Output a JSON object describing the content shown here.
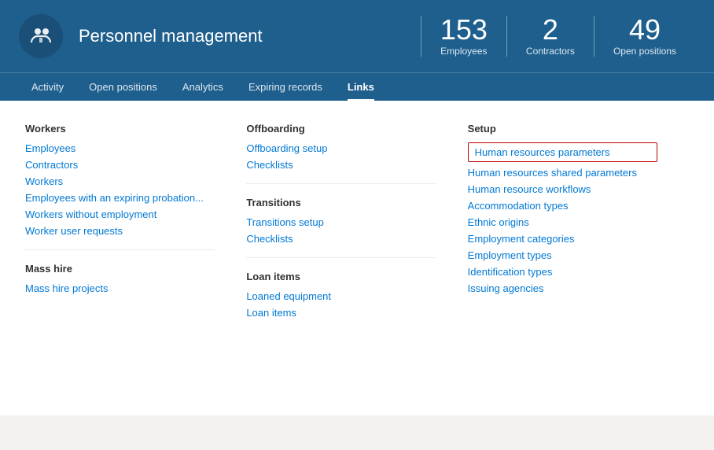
{
  "header": {
    "title": "Personnel management",
    "icon_label": "personnel-management-icon",
    "stats": [
      {
        "number": "153",
        "label": "Employees"
      },
      {
        "number": "2",
        "label": "Contractors"
      },
      {
        "number": "49",
        "label": "Open positions"
      }
    ]
  },
  "nav": {
    "items": [
      {
        "label": "Activity",
        "active": false
      },
      {
        "label": "Open positions",
        "active": false
      },
      {
        "label": "Analytics",
        "active": false
      },
      {
        "label": "Expiring records",
        "active": false
      },
      {
        "label": "Links",
        "active": true
      }
    ]
  },
  "content": {
    "columns": [
      {
        "id": "workers",
        "section_title": "Workers",
        "links": [
          "Employees",
          "Contractors",
          "Workers",
          "Employees with an expiring probation...",
          "Workers without employment",
          "Worker user requests"
        ],
        "subsections": [
          {
            "section_title": "Mass hire",
            "links": [
              "Mass hire projects"
            ]
          }
        ]
      },
      {
        "id": "offboarding",
        "section_title": "Offboarding",
        "links": [
          "Offboarding setup",
          "Checklists"
        ],
        "subsections": [
          {
            "section_title": "Transitions",
            "links": [
              "Transitions setup",
              "Checklists"
            ]
          },
          {
            "section_title": "Loan items",
            "links": [
              "Loaned equipment",
              "Loan items"
            ]
          }
        ]
      },
      {
        "id": "setup",
        "section_title": "Setup",
        "highlighted_link": "Human resources parameters",
        "links": [
          "Human resources shared parameters",
          "Human resource workflows",
          "Accommodation types",
          "Ethnic origins",
          "Employment categories",
          "Employment types",
          "Identification types",
          "Issuing agencies"
        ]
      }
    ]
  }
}
